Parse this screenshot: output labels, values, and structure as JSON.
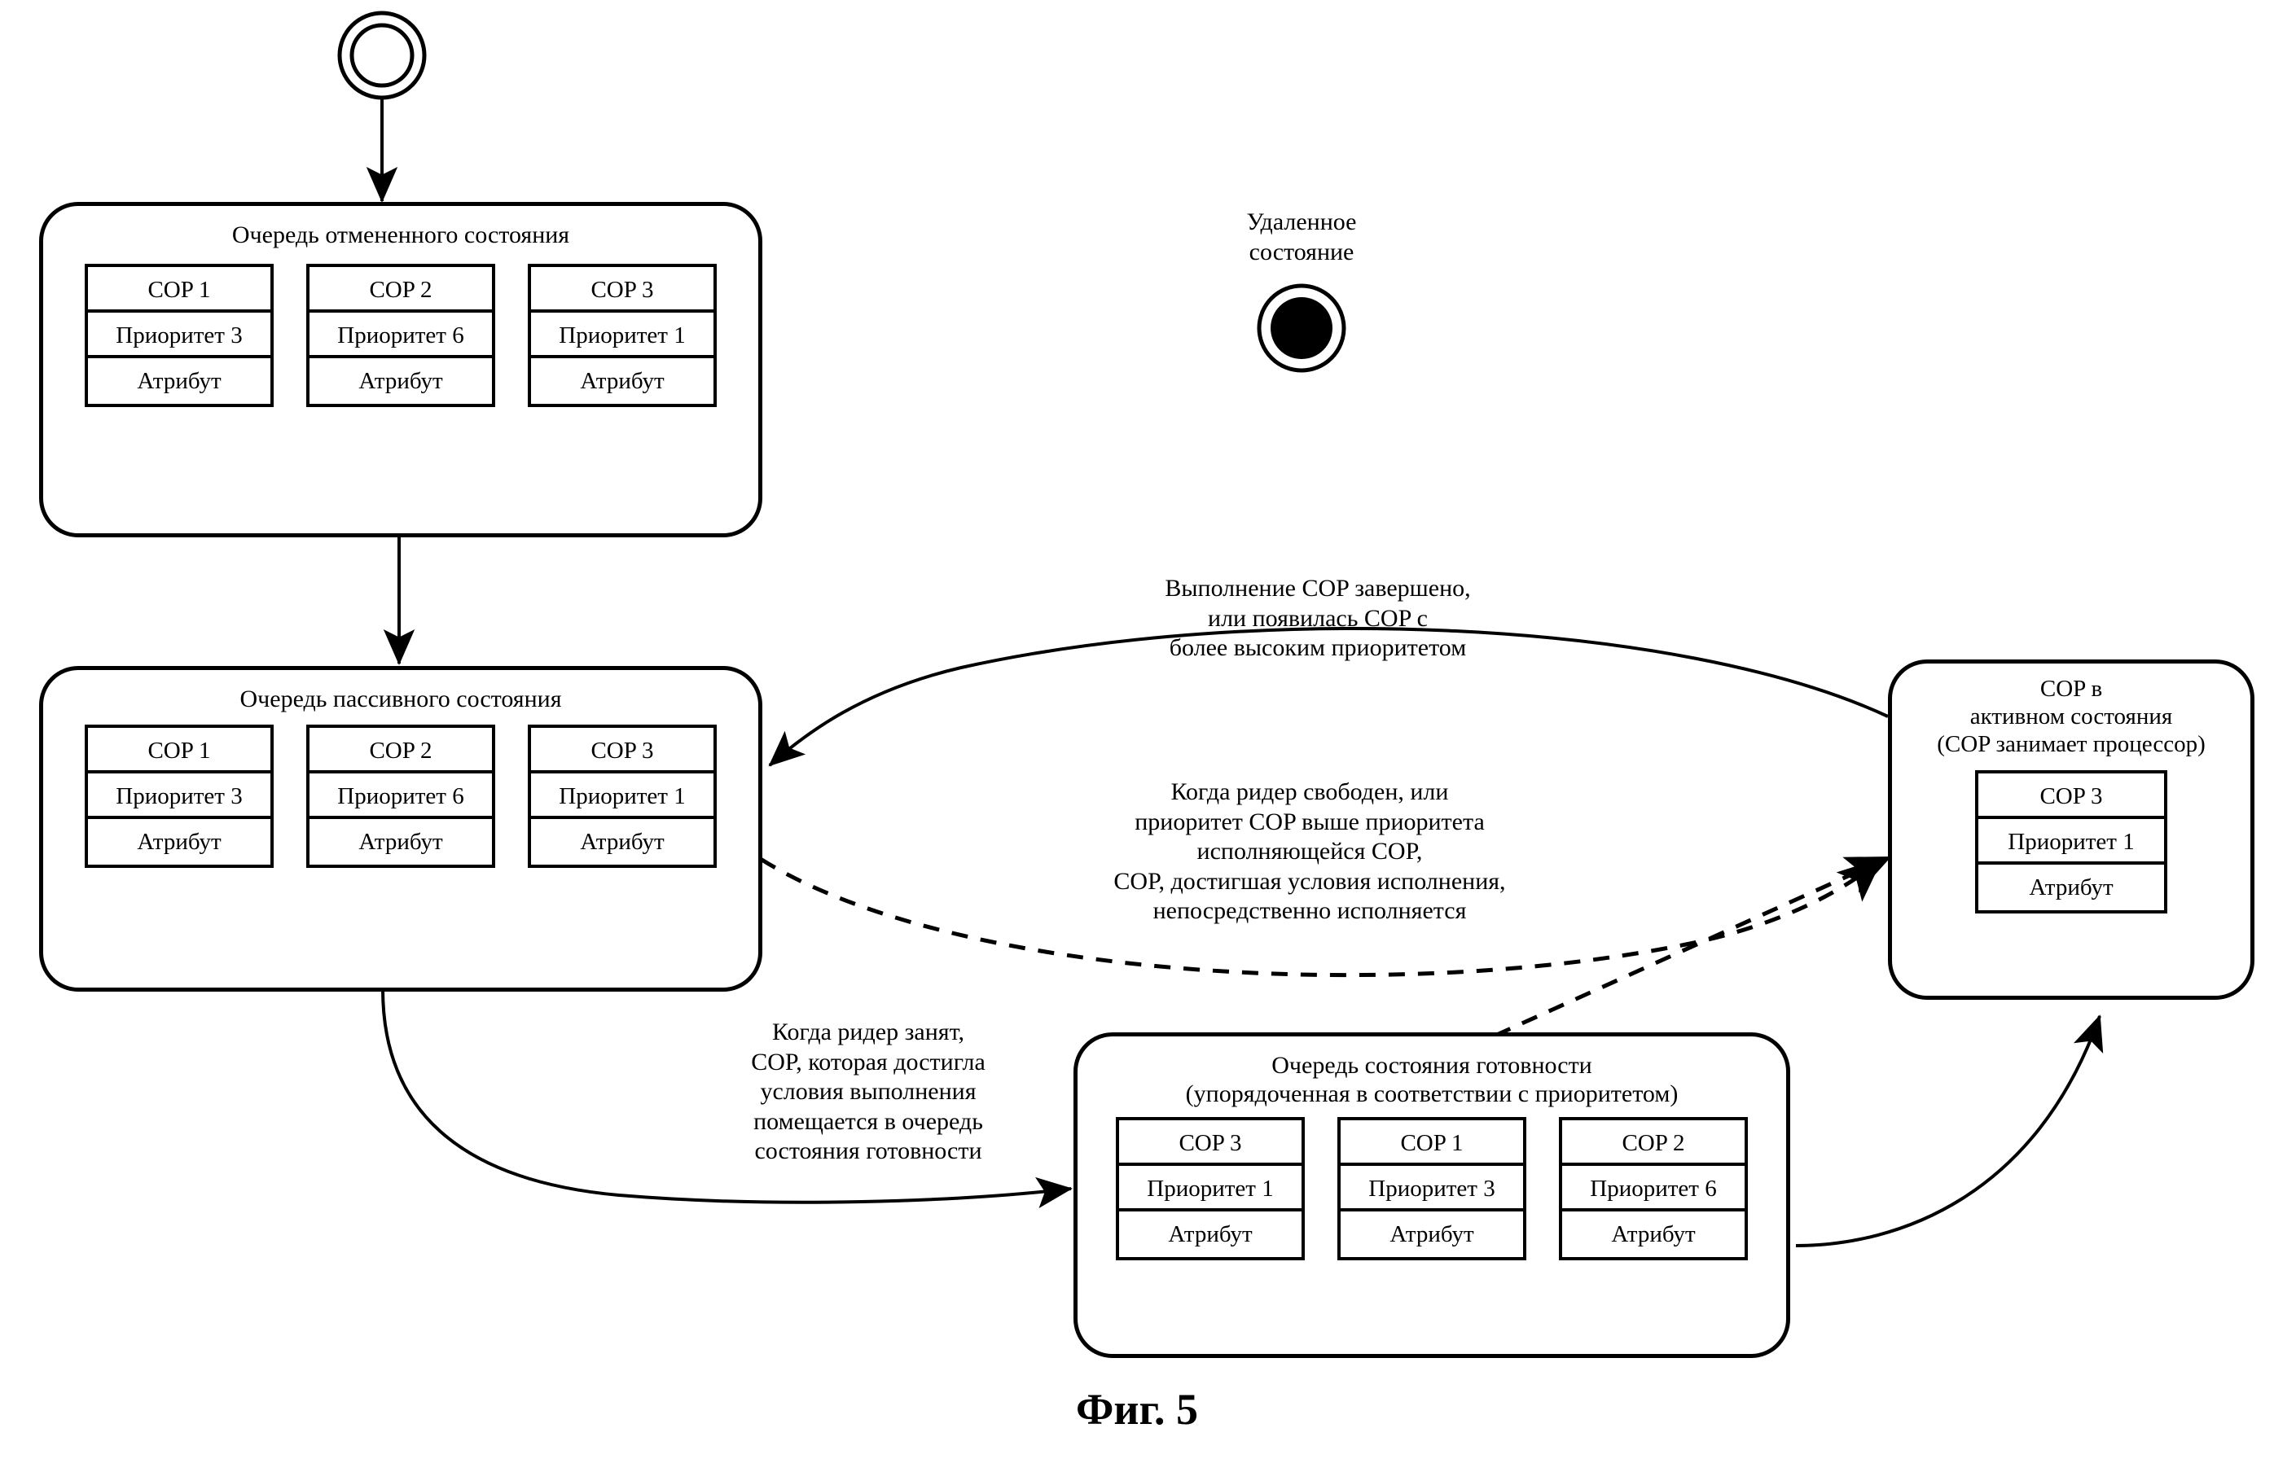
{
  "figure": {
    "caption": "Фиг. 5"
  },
  "nodes": {
    "initial_state": {
      "name": "initial-state-marker"
    },
    "final_state": {
      "label": "Удаленное\nсостояние",
      "name": "final-state-marker"
    },
    "cancelled_queue": {
      "title": "Очередь отмененного состояния",
      "cards": [
        {
          "cop": "COP 1",
          "priority": "Приоритет 3",
          "attribute": "Атрибут"
        },
        {
          "cop": "COP 2",
          "priority": "Приоритет 6",
          "attribute": "Атрибут"
        },
        {
          "cop": "COP 3",
          "priority": "Приоритет 1",
          "attribute": "Атрибут"
        }
      ]
    },
    "passive_queue": {
      "title": "Очередь пассивного состояния",
      "cards": [
        {
          "cop": "COP 1",
          "priority": "Приоритет 3",
          "attribute": "Атрибут"
        },
        {
          "cop": "COP 2",
          "priority": "Приоритет 6",
          "attribute": "Атрибут"
        },
        {
          "cop": "COP 3",
          "priority": "Приоритет 1",
          "attribute": "Атрибут"
        }
      ]
    },
    "ready_queue": {
      "title": "Очередь состояния готовности\n(упорядоченная в соответствии с приоритетом)",
      "cards": [
        {
          "cop": "COP 3",
          "priority": "Приоритет 1",
          "attribute": "Атрибут"
        },
        {
          "cop": "COP 1",
          "priority": "Приоритет 3",
          "attribute": "Атрибут"
        },
        {
          "cop": "COP 2",
          "priority": "Приоритет 6",
          "attribute": "Атрибут"
        }
      ]
    },
    "active_state": {
      "title": "COP в\nактивном состояния\n(COP занимает процессор)",
      "cards": [
        {
          "cop": "COP 3",
          "priority": "Приоритет 1",
          "attribute": "Атрибут"
        }
      ]
    }
  },
  "transitions": {
    "active_to_passive": "Выполнение COP завершено,\nили появилась COP с\nболее высоким приоритетом",
    "passive_to_active": "Когда ридер свободен, или\nприоритет COP выше приоритета\nисполняющейся COP,\nCOP, достигшая условия исполнения,\nнепосредственно исполняется",
    "passive_to_ready": "Когда ридер занят,\nCOP, которая достигла\nусловия выполнения\nпомещается в очередь\nсостояния готовности"
  },
  "colors": {
    "line": "#000000",
    "background": "#ffffff",
    "text": "#000000"
  }
}
